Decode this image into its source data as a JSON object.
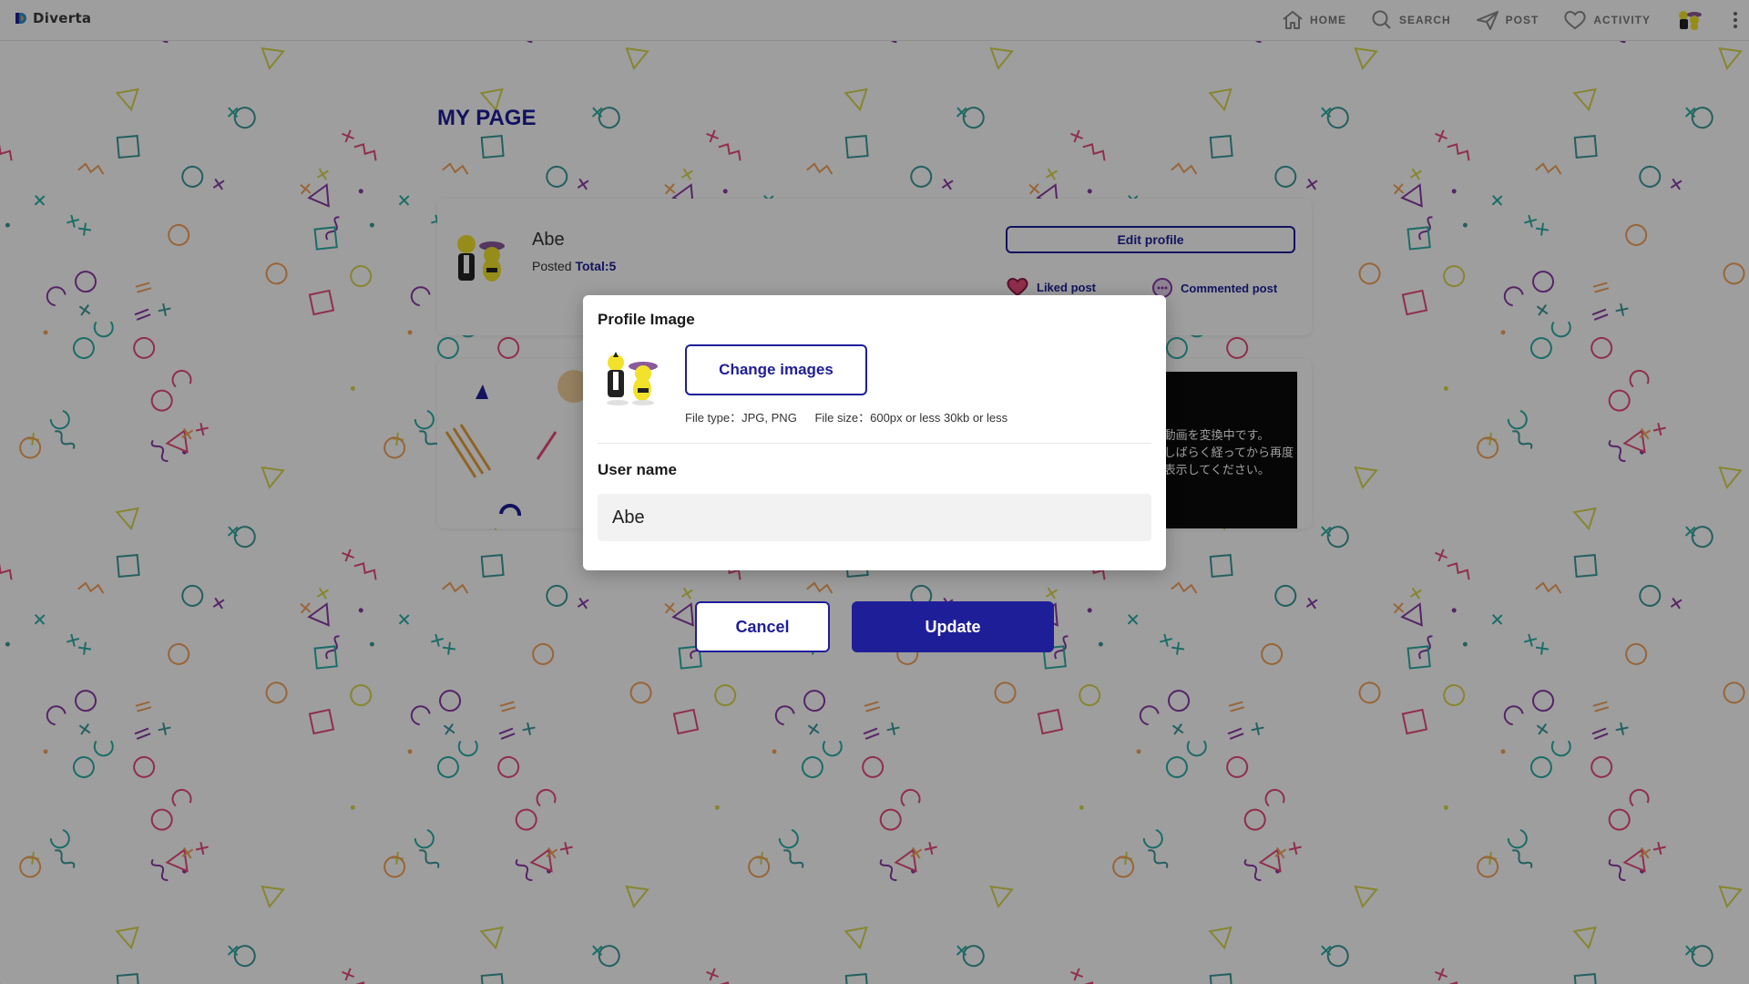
{
  "app": {
    "logo_text": "Diverta"
  },
  "nav": {
    "items": [
      {
        "label": "HOME",
        "icon": "home-icon"
      },
      {
        "label": "SEARCH",
        "icon": "search-icon"
      },
      {
        "label": "POST",
        "icon": "send-icon"
      },
      {
        "label": "ACTIVITY",
        "icon": "heart-icon"
      }
    ],
    "avatar_icon": "avatar-icon",
    "menu_icon": "kebab-menu-icon"
  },
  "page": {
    "title": "MY PAGE",
    "profile": {
      "name": "Abe",
      "posted_label": "Posted",
      "total": "Total:5",
      "edit_button": "Edit profile",
      "liked_post": "Liked post",
      "commented_post": "Commented post"
    },
    "video_message": "動画を変換中です。\nしばらく経ってから再度\n表示してください。"
  },
  "modal": {
    "title": "Profile Image",
    "change_button": "Change images",
    "file_type": "File type：JPG, PNG",
    "file_size": "File size：600px or less 30kb or less",
    "username_label": "User name",
    "username_value": "Abe",
    "cancel_button": "Cancel",
    "update_button": "Update"
  },
  "colors": {
    "primary": "#1f1e99",
    "overlay": "rgba(0,0,0,0.38)",
    "pattern": [
      "#2bb1a6",
      "#f5a35a",
      "#e84b7a",
      "#8b3aa6",
      "#d8d84e",
      "#3a9a9a"
    ]
  }
}
